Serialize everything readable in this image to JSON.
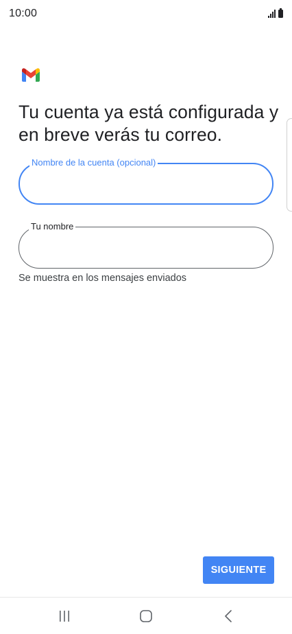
{
  "status_bar": {
    "time": "10:00",
    "icons": [
      "signal-icon",
      "battery-icon"
    ]
  },
  "app": {
    "logo": "gmail-logo",
    "brand_colors": {
      "blue": "#4285F4",
      "red": "#EA4335",
      "yellow": "#FBBC04",
      "green": "#34A853",
      "dark_red": "#C5221F"
    }
  },
  "heading": {
    "text": "Tu cuenta ya está configurada y en breve verás tu correo."
  },
  "account_name_field": {
    "label": "Nombre de la cuenta (opcional)",
    "value": "",
    "focused": true
  },
  "your_name_field": {
    "label": "Tu nombre",
    "value": "",
    "helper": "Se muestra en los mensajes enviados"
  },
  "next_button": {
    "label": "SIGUIENTE",
    "color": "#4285F4"
  },
  "nav_bar": {
    "icons": [
      "recents-icon",
      "home-icon",
      "back-icon"
    ]
  }
}
